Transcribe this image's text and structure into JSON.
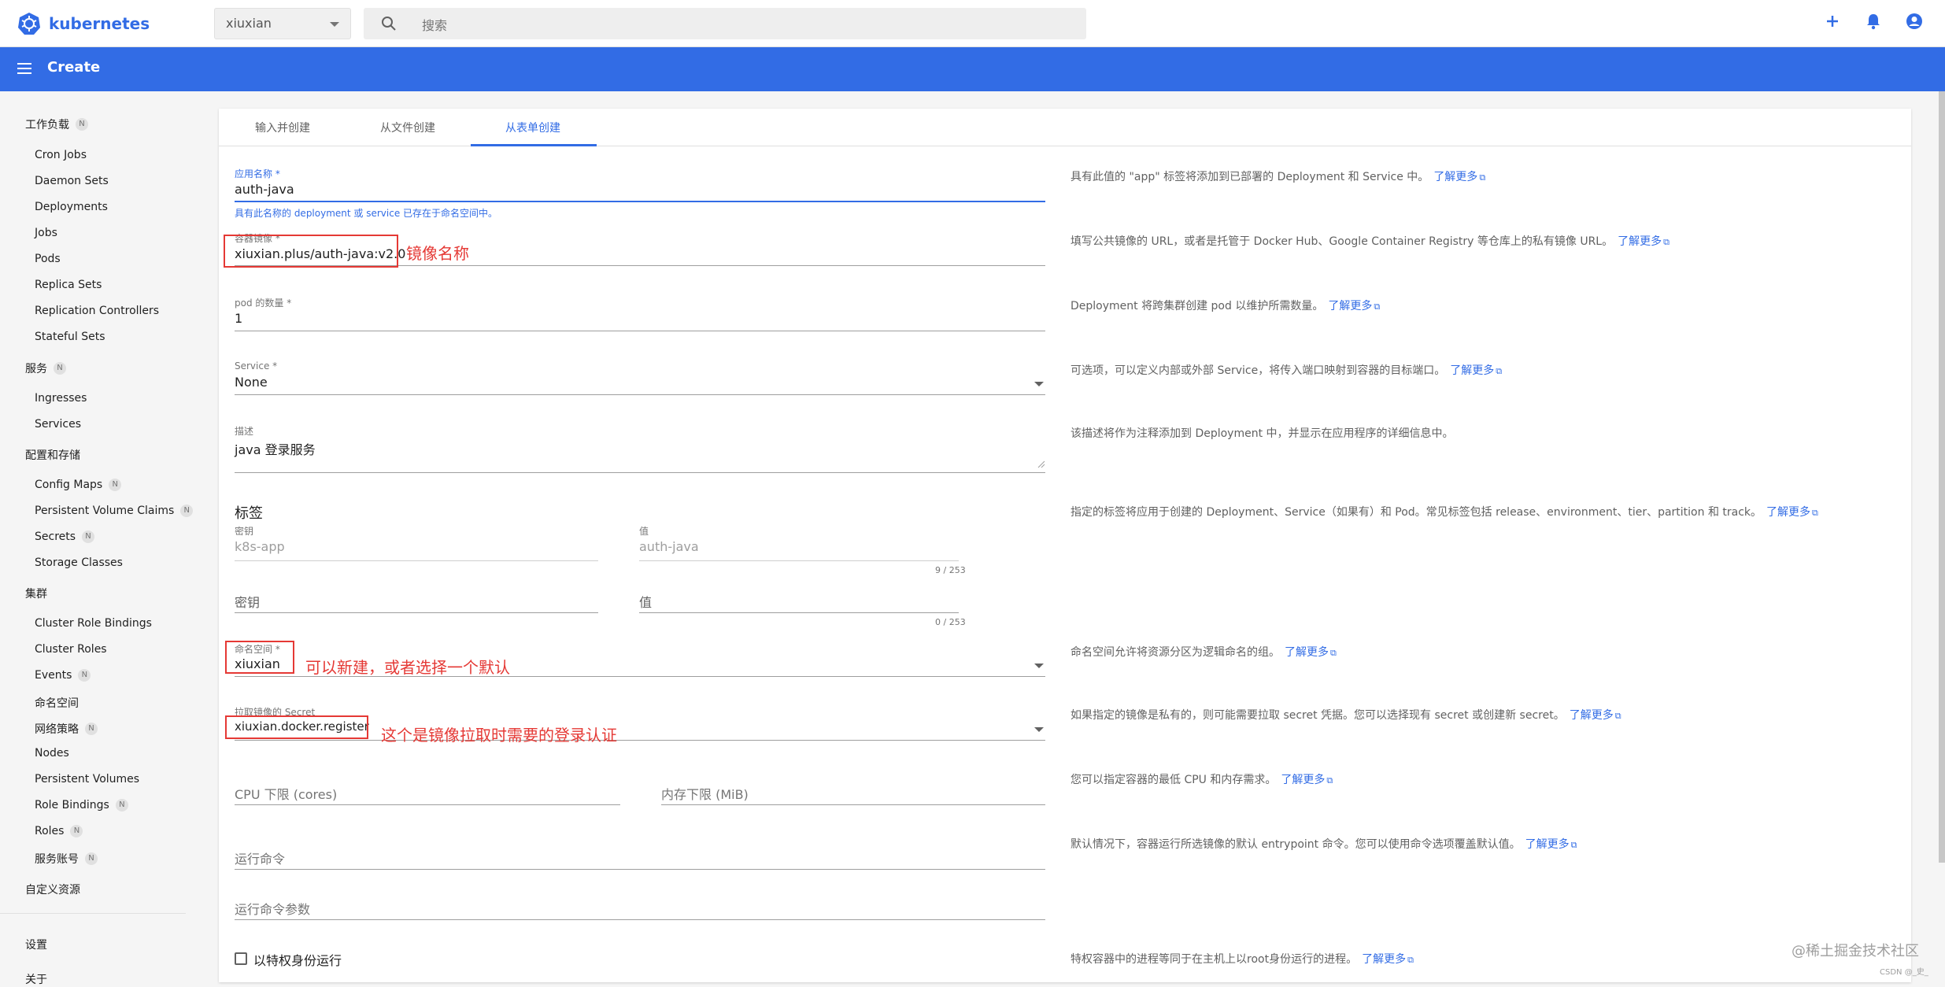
{
  "app": {
    "name": "kubernetes"
  },
  "namespace_select": {
    "value": "xiuxian"
  },
  "search": {
    "placeholder": "搜索"
  },
  "header": {
    "title": "Create"
  },
  "sidebar": {
    "sections": [
      {
        "label": "工作负载",
        "badge": "N"
      },
      {
        "label": "服务",
        "badge": "N"
      },
      {
        "label": "配置和存储"
      },
      {
        "label": "集群"
      },
      {
        "label": "自定义资源"
      },
      {
        "label": "设置"
      },
      {
        "label": "关于"
      }
    ],
    "items": [
      {
        "label": "Cron Jobs"
      },
      {
        "label": "Daemon Sets"
      },
      {
        "label": "Deployments"
      },
      {
        "label": "Jobs"
      },
      {
        "label": "Pods"
      },
      {
        "label": "Replica Sets"
      },
      {
        "label": "Replication Controllers"
      },
      {
        "label": "Stateful Sets"
      },
      {
        "label": "Ingresses"
      },
      {
        "label": "Services"
      },
      {
        "label": "Config Maps",
        "badge": "N"
      },
      {
        "label": "Persistent Volume Claims",
        "badge": "N"
      },
      {
        "label": "Secrets",
        "badge": "N"
      },
      {
        "label": "Storage Classes"
      },
      {
        "label": "Cluster Role Bindings"
      },
      {
        "label": "Cluster Roles"
      },
      {
        "label": "Events",
        "badge": "N"
      },
      {
        "label": "命名空间"
      },
      {
        "label": "网络策略",
        "badge": "N"
      },
      {
        "label": "Nodes"
      },
      {
        "label": "Persistent Volumes"
      },
      {
        "label": "Role Bindings",
        "badge": "N"
      },
      {
        "label": "Roles",
        "badge": "N"
      },
      {
        "label": "服务账号",
        "badge": "N"
      }
    ]
  },
  "tabs": [
    {
      "label": "输入并创建"
    },
    {
      "label": "从文件创建"
    },
    {
      "label": "从表单创建"
    }
  ],
  "form": {
    "app_name": {
      "label": "应用名称 *",
      "value": "auth-java",
      "hint": "具有此名称的 deployment 或 service 已存在于命名空间中。"
    },
    "image": {
      "label": "容器镜像 *",
      "value": "xiuxian.plus/auth-java:v2.0"
    },
    "pods": {
      "label": "pod 的数量 *",
      "value": "1"
    },
    "service": {
      "label": "Service *",
      "value": "None"
    },
    "description": {
      "label": "描述",
      "value": "java 登录服务"
    },
    "labels": {
      "title": "标签",
      "key_label": "密钥",
      "value_label": "值",
      "row1_key": "k8s-app",
      "row1_value": "auth-java",
      "row1_counter": "9 / 253",
      "row2_key": "密钥",
      "row2_value": "值",
      "row2_counter": "0 / 253"
    },
    "namespace": {
      "label": "命名空间 *",
      "value": "xiuxian"
    },
    "secret": {
      "label": "拉取镜像的 Secret",
      "value": "xiuxian.docker.register"
    },
    "cpu": {
      "placeholder": "CPU 下限 (cores)"
    },
    "memory": {
      "placeholder": "内存下限 (MiB)"
    },
    "command": {
      "placeholder": "运行命令"
    },
    "args": {
      "placeholder": "运行命令参数"
    },
    "privileged": {
      "label": "以特权身份运行",
      "checked": false
    }
  },
  "help": {
    "learn_more": "了解更多",
    "app_name": "具有此值的 \"app\" 标签将添加到已部署的 Deployment 和 Service 中。",
    "image": "填写公共镜像的 URL，或者是托管于 Docker Hub、Google Container Registry 等仓库上的私有镜像 URL。",
    "pods": "Deployment 将跨集群创建 pod 以维护所需数量。",
    "service": "可选项，可以定义内部或外部 Service，将传入端口映射到容器的目标端口。",
    "description": "该描述将作为注释添加到 Deployment 中，并显示在应用程序的详细信息中。",
    "labels": "指定的标签将应用于创建的 Deployment、Service（如果有）和 Pod。常见标签包括 release、environment、tier、partition 和 track。",
    "namespace": "命名空间允许将资源分区为逻辑命名的组。",
    "secret": "如果指定的镜像是私有的，则可能需要拉取 secret 凭据。您可以选择现有 secret 或创建新 secret。",
    "resources": "您可以指定容器的最低 CPU 和内存需求。",
    "command": "默认情况下，容器运行所选镜像的默认 entrypoint 命令。您可以使用命令选项覆盖默认值。",
    "privileged": "特权容器中的进程等同于在主机上以root身份运行的进程。"
  },
  "annotations": {
    "image": "镜像名称",
    "namespace": "可以新建，或者选择一个默认",
    "secret": "这个是镜像拉取时需要的登录认证"
  },
  "watermark": {
    "main": "@稀土掘金技术社区",
    "small": "CSDN @_史_"
  },
  "colors": {
    "brand": "#326ce5",
    "annotation": "#e53935"
  }
}
